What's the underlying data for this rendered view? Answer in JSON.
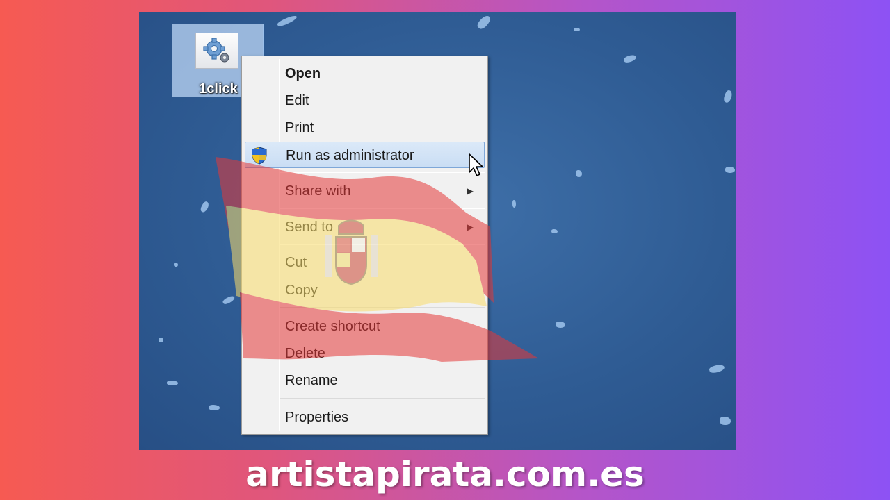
{
  "desktop": {
    "icon_label": "1click",
    "icon_name": "gears-icon"
  },
  "context_menu": {
    "items": [
      {
        "label": "Open",
        "bold": true
      },
      {
        "label": "Edit"
      },
      {
        "label": "Print"
      },
      {
        "label": "Run as administrator",
        "icon": "uac-shield-icon",
        "highlighted": true
      },
      {
        "label": "Share with",
        "submenu": true
      },
      {
        "label": "Send to",
        "submenu": true
      },
      {
        "label": "Cut"
      },
      {
        "label": "Copy"
      },
      {
        "label": "Create shortcut"
      },
      {
        "label": "Delete"
      },
      {
        "label": "Rename"
      },
      {
        "label": "Properties"
      }
    ],
    "submenu_glyph": "▶"
  },
  "overlay": {
    "graphic": "spanish-flag-icon"
  },
  "watermark": {
    "text": "artistapirata.com.es"
  },
  "colors": {
    "desktop_bg": "#2f5c94",
    "highlight": "#c9ddf4",
    "highlight_border": "#7ea7d8"
  }
}
